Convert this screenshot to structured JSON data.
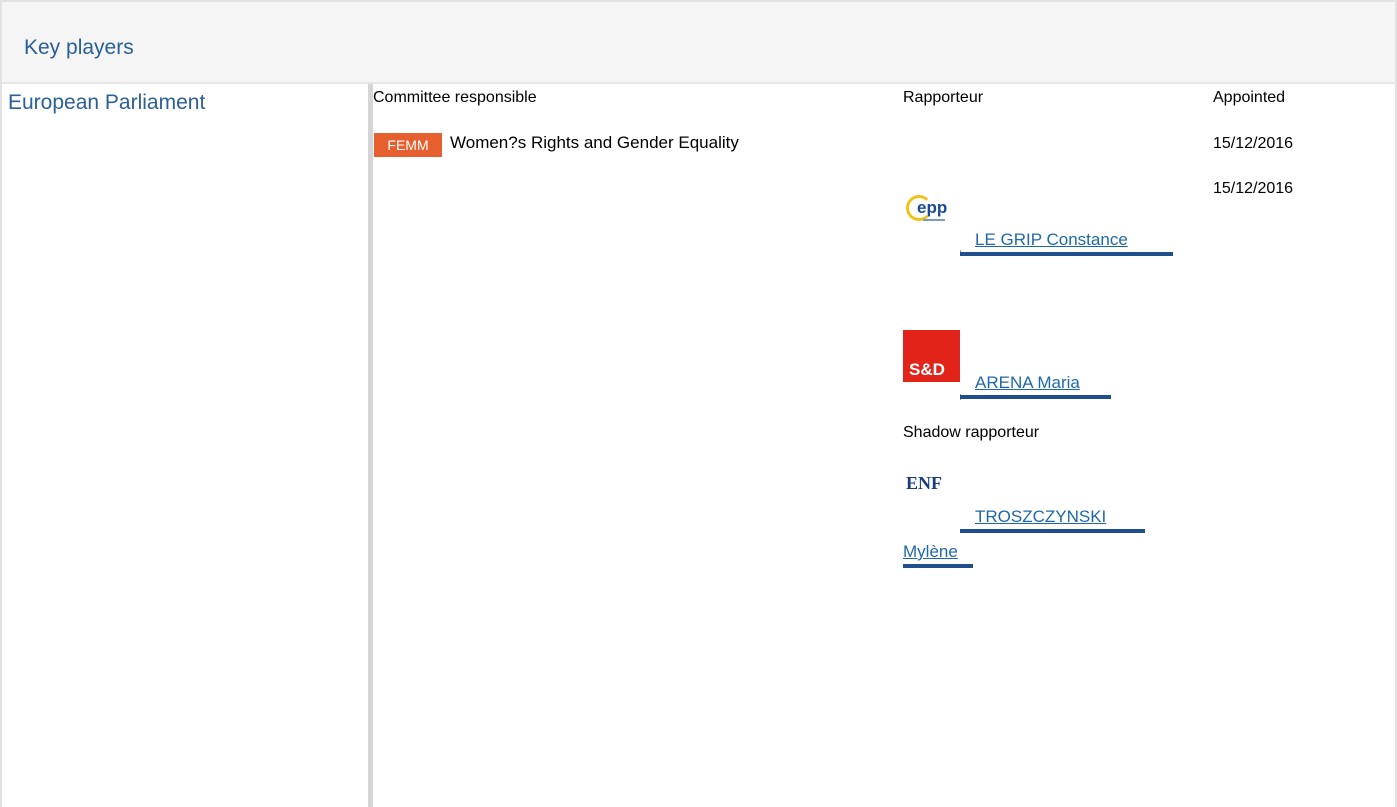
{
  "header": {
    "title": "Key players"
  },
  "institution": {
    "label": "European Parliament"
  },
  "columns": {
    "committee": "Committee responsible",
    "rapporteur": "Rapporteur",
    "appointed": "Appointed"
  },
  "committee": {
    "code": "FEMM",
    "name": "Women?s Rights and Gender Equality",
    "badge_color": "#e5602e"
  },
  "appointed_dates": [
    "15/12/2016",
    "15/12/2016"
  ],
  "rapporteurs": [
    {
      "name": "LE GRIP Constance",
      "group_logo": "epp-logo"
    },
    {
      "name": "ARENA Maria",
      "group_logo": "sd-logo"
    }
  ],
  "shadow": {
    "label": "Shadow rapporteur",
    "members": [
      {
        "name_line1": "TROSZCZYNSKI",
        "name_line2": "Mylène",
        "group_logo": "enf-logo"
      }
    ]
  },
  "logos": {
    "epp": "epp",
    "sd": "S&D",
    "enf": "ENF"
  },
  "colors": {
    "link": "#1f68a8",
    "heading": "#2a5f97",
    "underline": "#1f4e8a"
  }
}
